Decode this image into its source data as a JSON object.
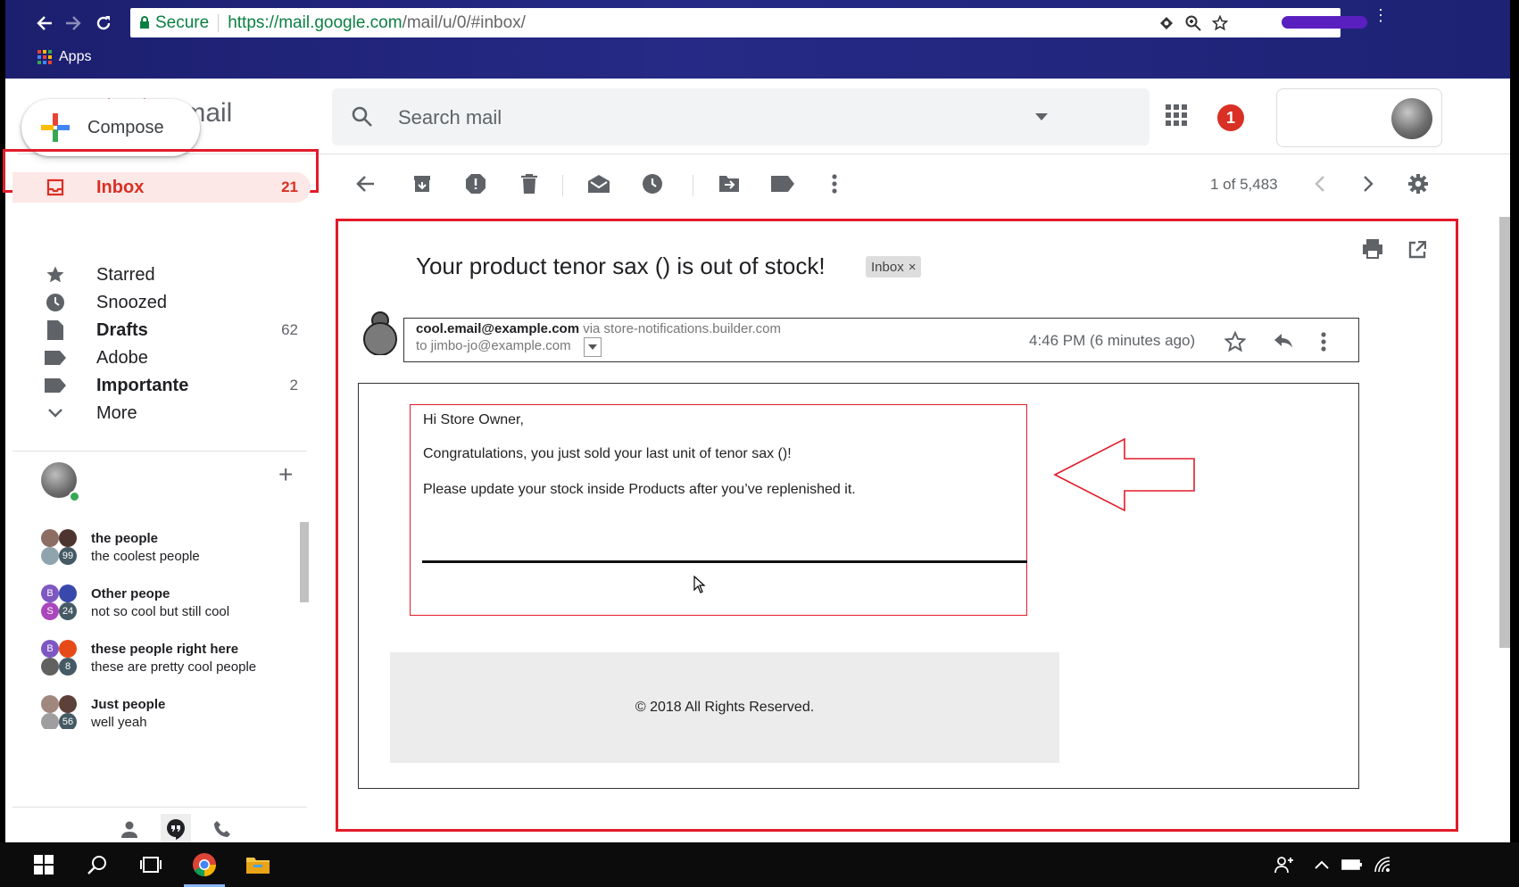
{
  "browser": {
    "security_label": "Secure",
    "url_host": "https://mail.google.com",
    "url_path": "/mail/u/0/#inbox/",
    "bookmarks_apps": "Apps"
  },
  "gmail": {
    "app_name": "Gmail",
    "search_placeholder": "Search mail",
    "notification_count": "1"
  },
  "sidebar": {
    "compose": "Compose",
    "items": [
      {
        "label": "Inbox",
        "count": "21",
        "icon": "inbox-icon"
      },
      {
        "label": "Starred",
        "count": "",
        "icon": "star-icon"
      },
      {
        "label": "Snoozed",
        "count": "",
        "icon": "clock-icon"
      },
      {
        "label": "Drafts",
        "count": "62",
        "icon": "draft-icon"
      },
      {
        "label": "Adobe",
        "count": "",
        "icon": "label-icon"
      },
      {
        "label": "Importante",
        "count": "2",
        "icon": "label-icon"
      },
      {
        "label": "More",
        "count": "",
        "icon": "chevron-down-icon"
      }
    ]
  },
  "hangouts": {
    "chats": [
      {
        "name": "the people",
        "snippet": "the coolest people",
        "badge": "99"
      },
      {
        "name": "Other peope",
        "snippet": "not so cool but still cool",
        "badge": "24"
      },
      {
        "name": "these people right here",
        "snippet": "these are pretty cool people",
        "badge": "8"
      },
      {
        "name": "Just people",
        "snippet": "well yeah",
        "badge": "56"
      }
    ]
  },
  "toolbar": {
    "pager": "1 of 5,483"
  },
  "message": {
    "subject": "Your product tenor sax () is out of stock!",
    "tag": "Inbox",
    "sender_email": "cool.email@example.com",
    "via": "via store-notifications.builder.com",
    "to": "to jimbo-jo@example.com",
    "time": "4:46 PM (6 minutes ago)",
    "greeting": "Hi Store Owner,",
    "line1": "Congratulations, you just sold your last unit of tenor sax ()!",
    "line2": "Please update your stock inside Products after you’ve replenished it.",
    "footer": "© 2018 All Rights Reserved."
  },
  "colors": {
    "accent_red": "#e21b2a",
    "gmail_red": "#d93025",
    "chrome_blue": "#262a86"
  }
}
